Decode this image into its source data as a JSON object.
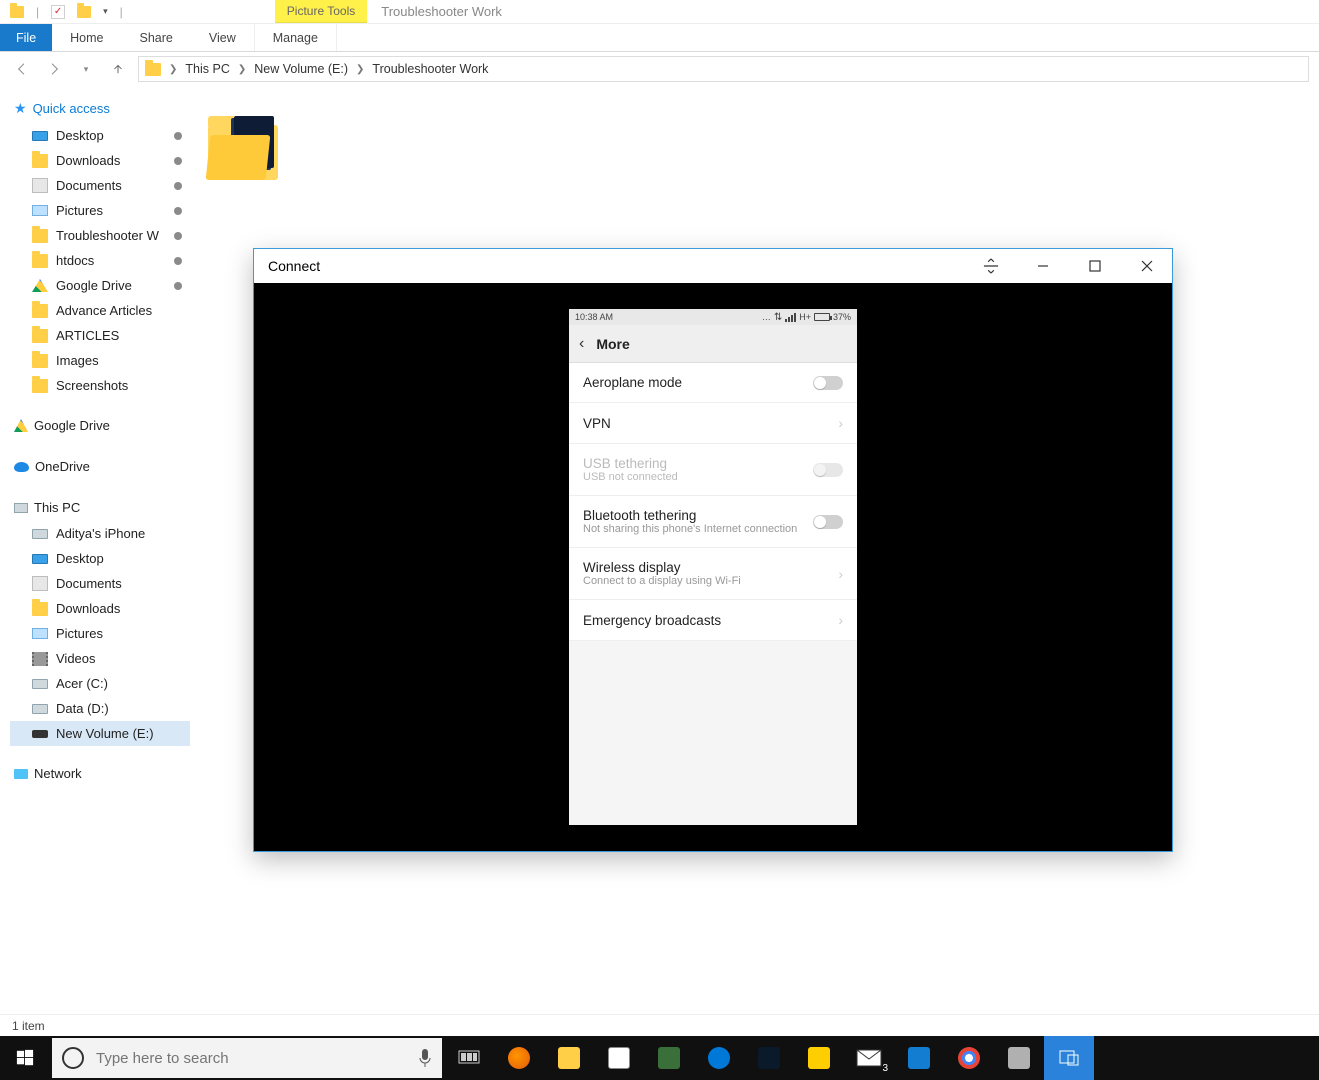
{
  "titlebar": {
    "tool_tab": "Picture Tools",
    "window_name": "Troubleshooter Work"
  },
  "ribbon": {
    "file": "File",
    "home": "Home",
    "share": "Share",
    "view": "View",
    "manage": "Manage"
  },
  "breadcrumb": [
    "This PC",
    "New Volume (E:)",
    "Troubleshooter Work"
  ],
  "tree": {
    "quick_access": "Quick access",
    "qa_items": [
      {
        "label": "Desktop",
        "pinned": true,
        "icon": "desk"
      },
      {
        "label": "Downloads",
        "pinned": true,
        "icon": "folder"
      },
      {
        "label": "Documents",
        "pinned": true,
        "icon": "doc"
      },
      {
        "label": "Pictures",
        "pinned": true,
        "icon": "pic"
      },
      {
        "label": "Troubleshooter W",
        "pinned": true,
        "icon": "folder"
      },
      {
        "label": "htdocs",
        "pinned": true,
        "icon": "folder"
      },
      {
        "label": "Google Drive",
        "pinned": true,
        "icon": "gd"
      },
      {
        "label": "Advance Articles",
        "pinned": false,
        "icon": "folder"
      },
      {
        "label": "ARTICLES",
        "pinned": false,
        "icon": "folder"
      },
      {
        "label": "Images",
        "pinned": false,
        "icon": "folder"
      },
      {
        "label": "Screenshots",
        "pinned": false,
        "icon": "folder"
      }
    ],
    "google_drive": "Google Drive",
    "onedrive": "OneDrive",
    "this_pc": "This PC",
    "pc_items": [
      {
        "label": "Aditya's iPhone",
        "icon": "drive"
      },
      {
        "label": "Desktop",
        "icon": "desk"
      },
      {
        "label": "Documents",
        "icon": "doc"
      },
      {
        "label": "Downloads",
        "icon": "folder"
      },
      {
        "label": "Pictures",
        "icon": "pic"
      },
      {
        "label": "Videos",
        "icon": "vid"
      },
      {
        "label": "Acer (C:)",
        "icon": "drive"
      },
      {
        "label": "Data (D:)",
        "icon": "drive"
      },
      {
        "label": "New Volume (E:)",
        "icon": "bat",
        "selected": true
      }
    ],
    "network": "Network"
  },
  "status": {
    "item_count": "1 item"
  },
  "search": {
    "placeholder": "Type here to search"
  },
  "connect_window": {
    "title": "Connect"
  },
  "phone": {
    "time": "10:38 AM",
    "net_label": "H+",
    "battery_pct": "37%",
    "appbar_title": "More",
    "items": {
      "airplane": {
        "title": "Aeroplane mode"
      },
      "vpn": {
        "title": "VPN"
      },
      "usb": {
        "title": "USB tethering",
        "sub": "USB not connected"
      },
      "bt": {
        "title": "Bluetooth tethering",
        "sub": "Not sharing this phone's Internet connection"
      },
      "wd": {
        "title": "Wireless display",
        "sub": "Connect to a display using Wi-Fi"
      },
      "eb": {
        "title": "Emergency broadcasts"
      }
    }
  }
}
